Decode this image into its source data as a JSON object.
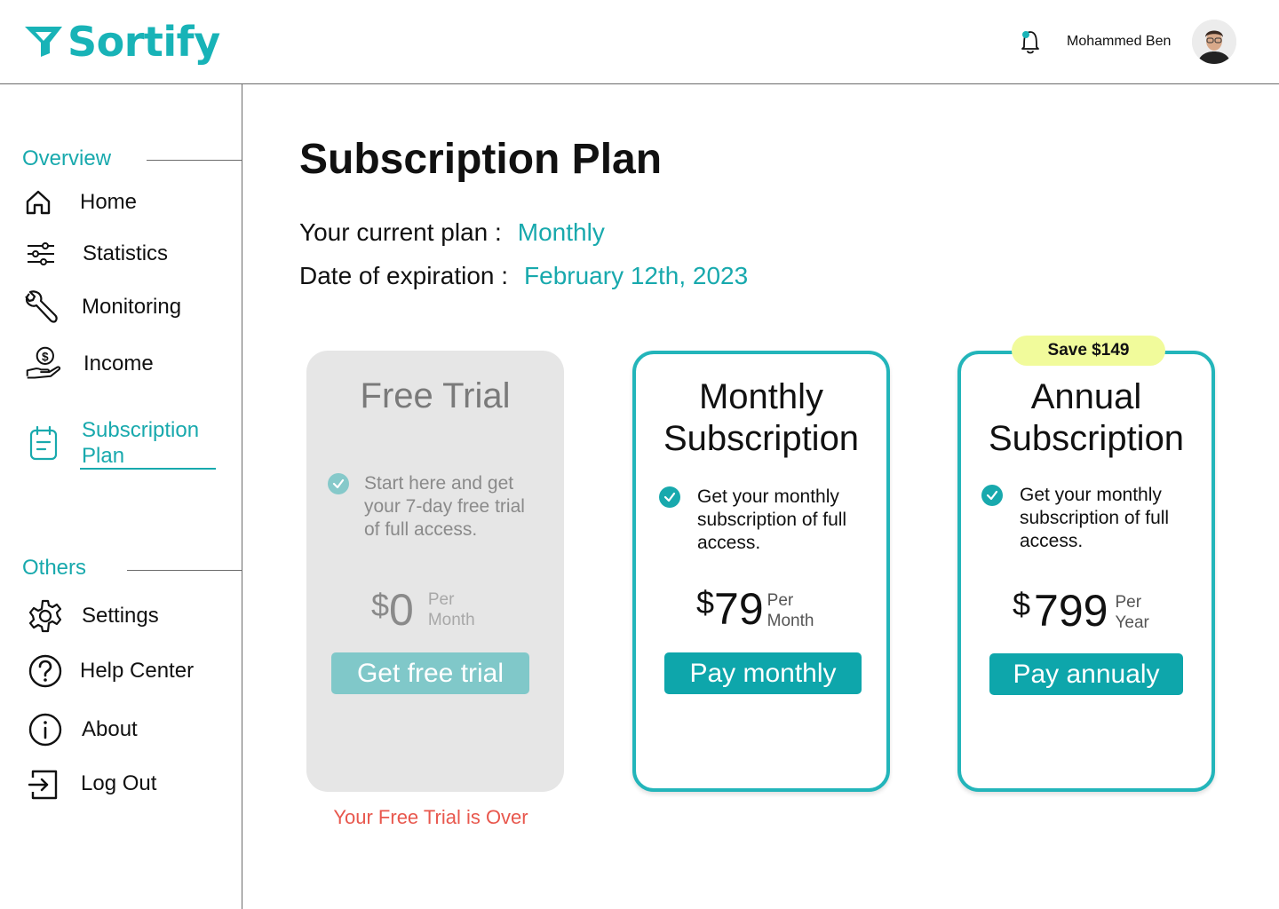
{
  "app": {
    "name": "Sortify"
  },
  "header": {
    "user_name": "Mohammed Ben"
  },
  "sidebar": {
    "overview_title": "Overview",
    "others_title": "Others",
    "overview_items": [
      {
        "label": "Home",
        "icon": "home-icon"
      },
      {
        "label": "Statistics",
        "icon": "sliders-icon"
      },
      {
        "label": "Monitoring",
        "icon": "wrench-icon"
      },
      {
        "label": "Income",
        "icon": "hand-coin-icon"
      },
      {
        "label": "Subscription Plan",
        "icon": "notepad-icon",
        "active": true
      }
    ],
    "others_items": [
      {
        "label": "Settings",
        "icon": "gear-icon"
      },
      {
        "label": "Help Center",
        "icon": "question-icon"
      },
      {
        "label": "About",
        "icon": "info-icon"
      },
      {
        "label": "Log Out",
        "icon": "logout-icon"
      }
    ]
  },
  "main": {
    "title": "Subscription Plan",
    "current_plan_label": "Your current plan :",
    "current_plan_value": "Monthly",
    "expiration_label": "Date of expiration :",
    "expiration_value": "February 12th, 2023",
    "plans": [
      {
        "title": "Free Trial",
        "feature": "Start here and get your 7-day free trial of full access.",
        "currency": "$",
        "price": "0",
        "per_line1": "Per",
        "per_line2": "Month",
        "button": "Get free trial",
        "disabled": true,
        "note": "Your Free Trial is Over"
      },
      {
        "title_line1": "Monthly",
        "title_line2": "Subscription",
        "feature": "Get your monthly subscription of full access.",
        "currency": "$",
        "price": "79",
        "per_line1": "Per",
        "per_line2": "Month",
        "button": "Pay monthly"
      },
      {
        "title_line1": "Annual",
        "title_line2": "Subscription",
        "badge": "Save $149",
        "feature": "Get your monthly subscription of full access.",
        "currency": "$",
        "price": "799",
        "per_line1": "Per",
        "per_line2": "Year",
        "button": "Pay annualy"
      }
    ]
  },
  "colors": {
    "accent": "#18a9ad",
    "button": "#0ea6ab",
    "card_border": "#23b5ba",
    "badge": "#f1fb9b",
    "warning": "#e8574d"
  }
}
